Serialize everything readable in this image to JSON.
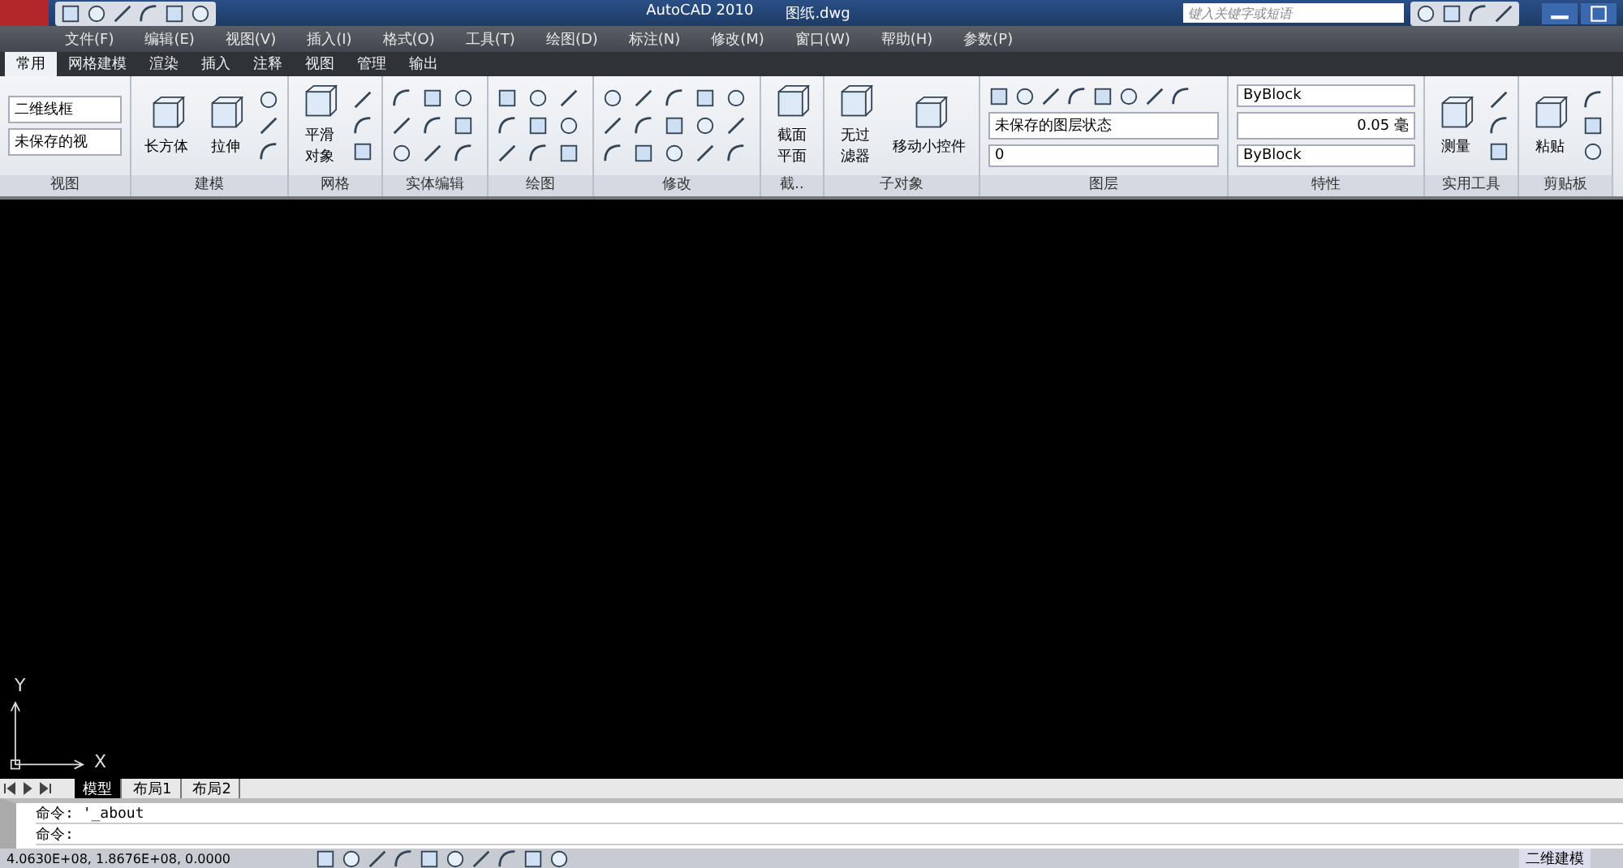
{
  "window": {
    "title": "AutoCAD 2010",
    "document": "图纸.dwg",
    "search": {
      "placeholder": "键入关键字或短语"
    }
  },
  "menu": [
    "文件(F)",
    "编辑(E)",
    "视图(V)",
    "插入(I)",
    "格式(O)",
    "工具(T)",
    "绘图(D)",
    "标注(N)",
    "修改(M)",
    "窗口(W)",
    "帮助(H)",
    "参数(P)"
  ],
  "ribbon_tabs": [
    {
      "label": "常用",
      "selected": true
    },
    {
      "label": "网格建模",
      "selected": false
    },
    {
      "label": "渲染",
      "selected": false
    },
    {
      "label": "插入",
      "selected": false
    },
    {
      "label": "注释",
      "selected": false
    },
    {
      "label": "视图",
      "selected": false
    },
    {
      "label": "管理",
      "selected": false
    },
    {
      "label": "输出",
      "selected": false
    }
  ],
  "panels": [
    {
      "kind": "dropdowns",
      "title": "视图",
      "items": [
        "二维线框",
        "未保存的视"
      ]
    },
    {
      "kind": "big",
      "title": "建模",
      "buttons": [
        "长方体",
        "拉伸"
      ]
    },
    {
      "kind": "big",
      "title": "网格",
      "buttons": [
        "平滑对象"
      ]
    },
    {
      "kind": "grid",
      "title": "实体编辑"
    },
    {
      "kind": "grid",
      "title": "绘图"
    },
    {
      "kind": "grid",
      "title": "修改"
    },
    {
      "kind": "big",
      "title": "截..",
      "buttons": [
        "截面平面"
      ]
    },
    {
      "kind": "big",
      "title": "子对象",
      "buttons": [
        "无过滤器",
        "移动小控件"
      ]
    },
    {
      "kind": "layers",
      "title": "图层",
      "state": "未保存的图层状态",
      "layer": "0"
    },
    {
      "kind": "properties",
      "title": "特性",
      "color_name": "ByBlock",
      "lineweight": "0.05 毫",
      "linetype": "ByBlock"
    },
    {
      "kind": "big",
      "title": "实用工具",
      "buttons": [
        "测量"
      ]
    },
    {
      "kind": "big",
      "title": "剪贴板",
      "buttons": [
        "粘贴"
      ]
    }
  ],
  "axes": {
    "x": "X",
    "y": "Y"
  },
  "layout_tabs": [
    {
      "label": "模型",
      "selected": true
    },
    {
      "label": "布局1",
      "selected": false
    },
    {
      "label": "布局2",
      "selected": false
    }
  ],
  "command_lines": [
    "命令: '_about",
    "命令:"
  ],
  "status_bar": {
    "coordinates": "4.0630E+08, 1.8676E+08, 0.0000",
    "workspace": "二维建模"
  }
}
